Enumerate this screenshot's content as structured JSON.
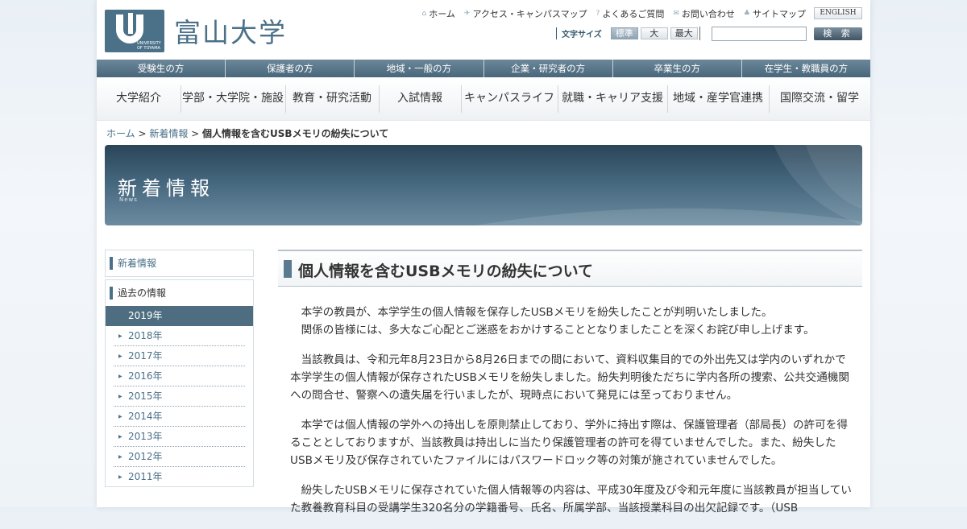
{
  "header": {
    "logo_text": "富山大学",
    "logo_small": "UNIVERSITY OF TOYAMA",
    "util_nav": [
      {
        "icon": "home-icon",
        "label": "ホーム"
      },
      {
        "icon": "map-icon",
        "label": "アクセス・キャンパスマップ"
      },
      {
        "icon": "question-icon",
        "label": "よくあるご質問"
      },
      {
        "icon": "mail-icon",
        "label": "お問い合わせ"
      },
      {
        "icon": "sitemap-icon",
        "label": "サイトマップ"
      }
    ],
    "english_label": "ENGLISH",
    "fontsize_label": "文字サイズ",
    "fontsize_options": [
      "標準",
      "大",
      "最大"
    ],
    "search_placeholder": "",
    "search_button": "検 索"
  },
  "audience_nav": [
    "受験生の方",
    "保護者の方",
    "地域・一般の方",
    "企業・研究者の方",
    "卒業生の方",
    "在学生・教職員の方"
  ],
  "main_nav": [
    "大学紹介",
    "学部・大学院・施設",
    "教育・研究活動",
    "入試情報",
    "キャンパスライフ",
    "就職・キャリア支援",
    "地域・産学官連携",
    "国際交流・留学"
  ],
  "breadcrumb": {
    "home": "ホーム",
    "sep": " > ",
    "section": "新着情報",
    "current": "個人情報を含むUSBメモリの紛失について"
  },
  "banner": {
    "title": "新着情報",
    "subtitle": "News"
  },
  "sidebar": {
    "news_label": "新着情報",
    "past_label": "過去の情報",
    "active_year": "2019年",
    "years": [
      "2018年",
      "2017年",
      "2016年",
      "2015年",
      "2014年",
      "2013年",
      "2012年",
      "2011年"
    ]
  },
  "article": {
    "title": "個人情報を含むUSBメモリの紛失について",
    "p1a": "本学の教員が、本学学生の個人情報を保存したUSBメモリを紛失したことが判明いたしました。",
    "p1b": "関係の皆様には、多大なご心配とご迷惑をおかけすることとなりましたことを深くお詫び申し上げます。",
    "p2": "当該教員は、令和元年8月23日から8月26日までの間において、資料収集目的での外出先又は学内のいずれかで本学学生の個人情報が保存されたUSBメモリを紛失しました。紛失判明後ただちに学内各所の捜索、公共交通機関への問合せ、警察への遺失届を行いましたが、現時点において発見には至っておりません。",
    "p3": "本学では個人情報の学外への持出しを原則禁止しており、学外に持出す際は、保護管理者（部局長）の許可を得ることとしておりますが、当該教員は持出しに当たり保護管理者の許可を得ていませんでした。また、紛失したUSBメモリ及び保存されていたファイルにはパスワードロック等の対策が施されていませんでした。",
    "p4": "紛失したUSBメモリに保存されていた個人情報等の内容は、平成30年度及び令和元年度に当該教員が担当していた教養教育科目の受講学生320名分の学籍番号、氏名、所属学部、当該授業科目の出欠記録です。（USB"
  },
  "colors": {
    "brand": "#4b7189",
    "nav_bar": "#4e6d81",
    "banner_dark": "#2b4558"
  }
}
